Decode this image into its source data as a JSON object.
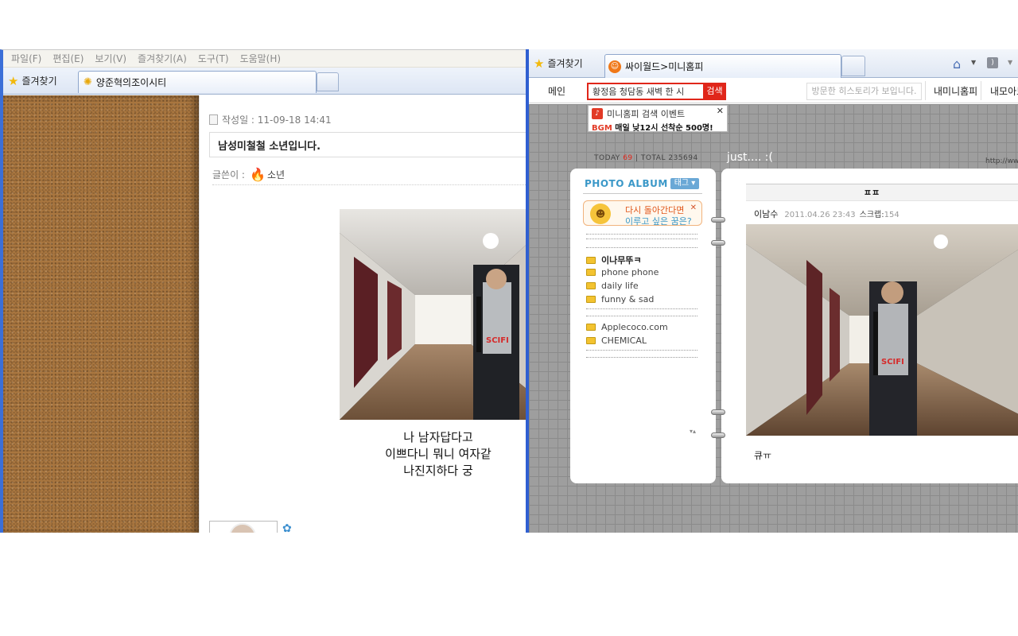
{
  "left_window": {
    "menu": [
      "파일(F)",
      "편집(E)",
      "보기(V)",
      "즐겨찾기(A)",
      "도구(T)",
      "도움말(H)"
    ],
    "favorites_label": "즐겨찾기",
    "tab_title": "양준혁의조이시티",
    "post": {
      "date": "작성일 : 11-09-18 14:41",
      "title": "남성미철철 소년입니다.",
      "writer_label": "글쓴이 :",
      "writer_name": "소년",
      "poem": [
        "나 남자답다고",
        "이쁘다니 뭐니 여자같",
        "나진지하다 궁"
      ]
    }
  },
  "right_window": {
    "favorites_label": "즐겨찾기",
    "tab_title": "싸이월드>미니홈피",
    "nav": {
      "main": "메인",
      "search_value": "황정음 청담동 새벽 한 시",
      "search_button": "검색",
      "history": "방문한 히스토리가 보입니다.",
      "my_minihompy": "내미니홈피",
      "my_collection": "내모아보"
    },
    "event_popup": {
      "title": "미니홈피 검색 이벤트",
      "bgm": "BGM",
      "subtitle": "매일 낮12시 선착순 500명!"
    },
    "counter": {
      "today_label": "TODAY",
      "today_value": "69",
      "total_label": "TOTAL",
      "total_value": "235694"
    },
    "homepage_title": "just.... :(",
    "url_text": "http://www",
    "album": {
      "title": "PHOTO ALBUM",
      "tag_button": "태그 ▾",
      "dream_line1": "다시 돌아간다면",
      "dream_line2": "이루고 싶은 꿈은?",
      "folders_group1": [
        "이나무뚜ㅋ",
        "phone phone",
        "daily life",
        "funny & sad"
      ],
      "folders_group2": [
        "Applecoco.com",
        "CHEMICAL"
      ]
    },
    "post": {
      "header": "ㅍㅍ",
      "author": "이남수",
      "date": "2011.04.26 23:43",
      "scrap_label": "스크랩:",
      "scrap_count": "154",
      "caption": "큐ㅠ"
    }
  },
  "colors": {
    "cy_red": "#e0261a",
    "album_blue": "#3b98c8",
    "window_border_blue": "#2f5fd1",
    "cork_brown": "#a9763f"
  }
}
